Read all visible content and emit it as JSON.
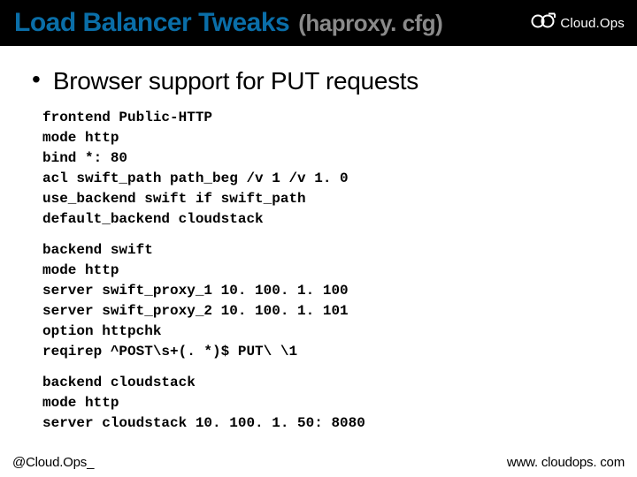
{
  "title": {
    "main": "Load Balancer Tweaks",
    "sub": "(haproxy. cfg)"
  },
  "logo": {
    "text": "Cloud.Ops",
    "icon_name": "cloudops-logo-icon"
  },
  "bullet1": "Browser support for PUT requests",
  "code": {
    "frontend": "frontend Public-HTTP\nmode http\nbind *: 80\nacl swift_path path_beg /v 1 /v 1. 0\nuse_backend swift if swift_path\ndefault_backend cloudstack",
    "backend_swift": "backend swift\nmode http\nserver swift_proxy_1 10. 100. 1. 100\nserver swift_proxy_2 10. 100. 1. 101\noption httpchk\nreqirep ^POST\\s+(. *)$ PUT\\ \\1",
    "backend_cloudstack": "backend cloudstack\nmode http\nserver cloudstack 10. 100. 1. 50: 8080"
  },
  "footer": {
    "left": "@Cloud.Ops_",
    "right": "www. cloudops. com"
  }
}
